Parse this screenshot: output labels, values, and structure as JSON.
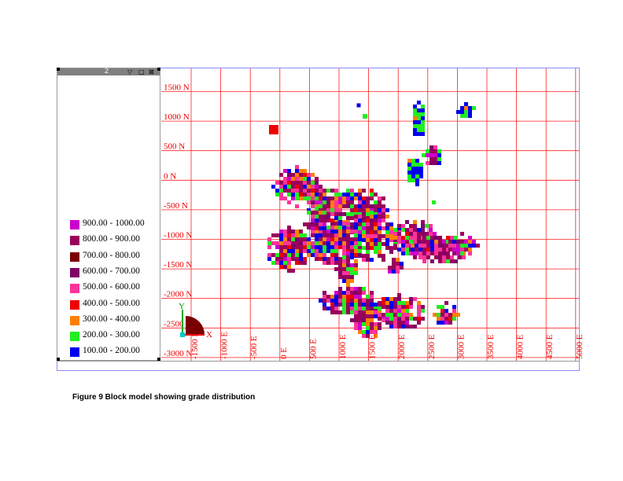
{
  "panel": {
    "title": "2",
    "buttons": [
      {
        "name": "collapse",
        "glyph": "▽"
      },
      {
        "name": "restore",
        "glyph": "□"
      },
      {
        "name": "close",
        "glyph": "⊠"
      }
    ]
  },
  "legend": [
    {
      "label": "900.00 - 1000.00",
      "color": "#cc00cc"
    },
    {
      "label": "800.00 - 900.00",
      "color": "#99005c"
    },
    {
      "label": "700.00 - 800.00",
      "color": "#7a0000"
    },
    {
      "label": "600.00 - 700.00",
      "color": "#800066"
    },
    {
      "label": "500.00 - 600.00",
      "color": "#ff3399"
    },
    {
      "label": "400.00 - 500.00",
      "color": "#ee0000"
    },
    {
      "label": "300.00 - 400.00",
      "color": "#ff8000"
    },
    {
      "label": "200.00 - 300.00",
      "color": "#22ee22"
    },
    {
      "label": "100.00 - 200.00",
      "color": "#0000ee"
    }
  ],
  "grid": {
    "northing_labels": [
      "1500 N",
      "1000 N",
      "500 N",
      "0 N",
      "-500 N",
      "-1000 N",
      "-1500 N",
      "-2000 N",
      "-2500 N",
      "-3000 N"
    ],
    "easting_labels": [
      "-1500 E",
      "-1000 E",
      "-500 E",
      "0 E",
      "500 E",
      "1000 E",
      "1500 E",
      "2000 E",
      "2500 E",
      "3000 E",
      "3500 E",
      "4000 E",
      "4500 E",
      "5000 E"
    ],
    "line_color": "#ff2020",
    "label_color": "#ee0000"
  },
  "axes_indicator": {
    "x_label": "X",
    "y_label": "Y"
  },
  "caption": "Figure 9 Block model showing grade distribution"
}
